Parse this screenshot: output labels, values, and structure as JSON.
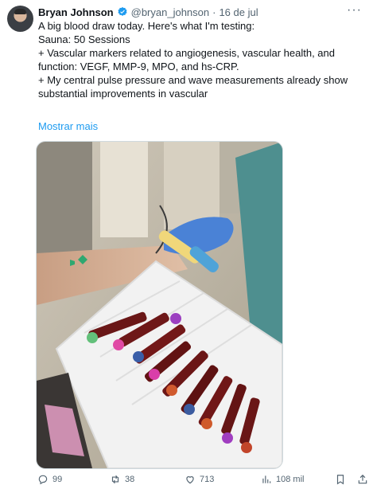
{
  "tweet": {
    "author_name": "Bryan Johnson",
    "handle": "@bryan_johnson",
    "separator": "·",
    "date": "16 de jul",
    "lines": [
      "A big blood draw today. Here's what I'm testing:",
      "",
      "Sauna: 50 Sessions",
      "+ Vascular markers related to angiogenesis, vascular health, and function: VEGF, MMP-9, MPO, and hs-CRP.",
      "",
      "+ My central pulse pressure and wave measurements already show substantial improvements in vascular"
    ],
    "show_more": "Mostrar mais"
  },
  "actions": {
    "replies": "99",
    "reposts": "38",
    "likes": "713",
    "views": "108 mil"
  },
  "colors": {
    "accent": "#1d9bf0",
    "text": "#0f1419",
    "muted": "#536471"
  },
  "icons": [
    "verified-badge-icon",
    "more-icon",
    "reply-icon",
    "repost-icon",
    "like-icon",
    "views-icon",
    "bookmark-icon",
    "share-icon"
  ]
}
